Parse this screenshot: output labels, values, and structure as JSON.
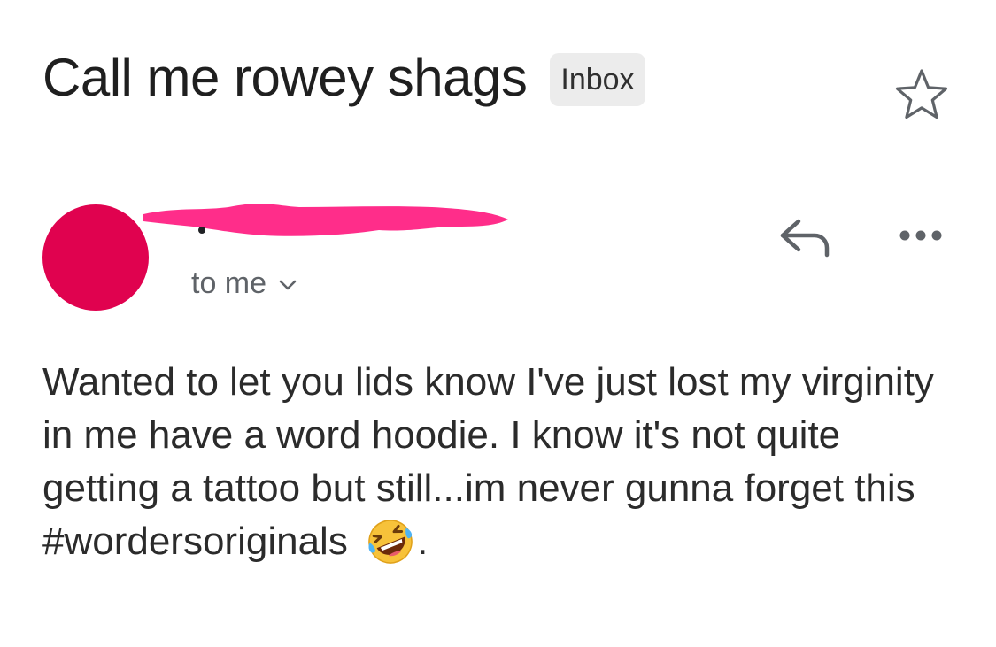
{
  "email": {
    "subject": "Call me rowey shags",
    "label": "Inbox",
    "recipient": "to me",
    "body_main": "Wanted to let you lids know I've just lost my virginity in me have a word hoodie. I know it's not quite getting a tattoo but still...im never gunna forget this #wordersoriginals",
    "body_end": "."
  },
  "icons": {
    "star": "star-outline-icon",
    "reply": "reply-icon",
    "more": "more-horizontal-icon",
    "chevron": "chevron-down-icon",
    "emoji": "rolling-on-floor-laughing-emoji"
  },
  "colors": {
    "avatar": "#e0024f",
    "redaction": "#ff2d8a",
    "label_bg": "#ececec"
  }
}
